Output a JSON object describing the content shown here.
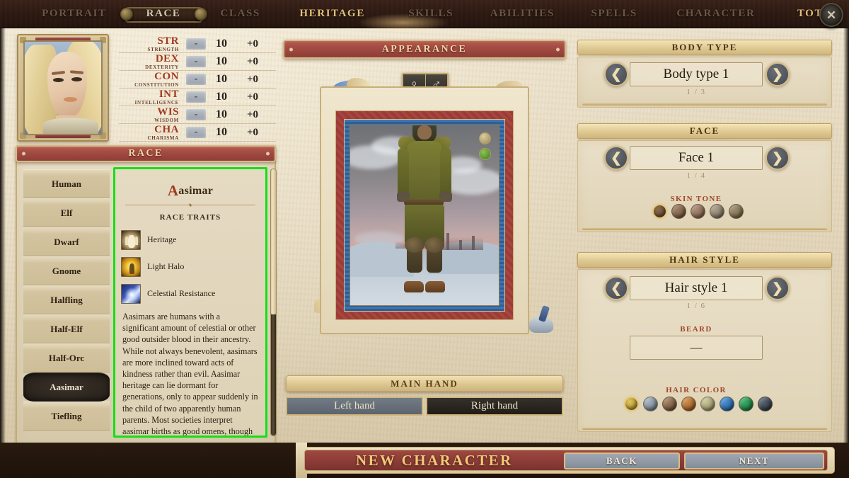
{
  "topbar": {
    "tabs": [
      {
        "label": "PORTRAIT",
        "state": "dim"
      },
      {
        "label": "RACE",
        "state": "active"
      },
      {
        "label": "CLASS",
        "state": "dim"
      },
      {
        "label": "HERITAGE",
        "state": "gold"
      },
      {
        "label": "SKILLS",
        "state": "dim"
      },
      {
        "label": "ABILITIES",
        "state": "dim"
      },
      {
        "label": "SPELLS",
        "state": "dim"
      },
      {
        "label": "CHARACTER",
        "state": "dim"
      },
      {
        "label": "TOTAL",
        "state": "gold"
      }
    ],
    "close_icon": "close-icon",
    "close_glyph": "✕"
  },
  "stats": {
    "rows": [
      {
        "abbr": "STR",
        "name": "STRENGTH",
        "minus": "-",
        "value": "10",
        "mod": "+0"
      },
      {
        "abbr": "DEX",
        "name": "DEXTERITY",
        "minus": "-",
        "value": "10",
        "mod": "+0"
      },
      {
        "abbr": "CON",
        "name": "CONSTITUTION",
        "minus": "-",
        "value": "10",
        "mod": "+0"
      },
      {
        "abbr": "INT",
        "name": "INTELLIGENCE",
        "minus": "-",
        "value": "10",
        "mod": "+0"
      },
      {
        "abbr": "WIS",
        "name": "WISDOM",
        "minus": "-",
        "value": "10",
        "mod": "+0"
      },
      {
        "abbr": "CHA",
        "name": "CHARISMA",
        "minus": "-",
        "value": "10",
        "mod": "+0"
      }
    ]
  },
  "race_section": {
    "banner_label": "RACE",
    "list": [
      {
        "label": "Human",
        "selected": false
      },
      {
        "label": "Elf",
        "selected": false
      },
      {
        "label": "Dwarf",
        "selected": false
      },
      {
        "label": "Gnome",
        "selected": false
      },
      {
        "label": "Halfling",
        "selected": false
      },
      {
        "label": "Half-Elf",
        "selected": false
      },
      {
        "label": "Half-Orc",
        "selected": false
      },
      {
        "label": "Aasimar",
        "selected": true
      },
      {
        "label": "Tiefling",
        "selected": false
      }
    ],
    "detail": {
      "title_dropcap": "A",
      "title_rest": "asimar",
      "traits_heading": "RACE TRAITS",
      "traits": [
        {
          "label": "Heritage",
          "icon": "heritage-icon"
        },
        {
          "label": "Light Halo",
          "icon": "light-halo-icon"
        },
        {
          "label": "Celestial Resistance",
          "icon": "celestial-resistance-icon"
        }
      ],
      "description": "Aasimars are humans with a significant amount of celestial or other good outsider blood in their ancestry. While not always benevolent, aasimars are more inclined toward acts of kindness rather than evil. Aasimar heritage can lie dormant for generations, only to appear suddenly in the child of two apparently human parents. Most societies interpret aasimar births as good omens, though it must be acknowledged that some aasimars take advantage of the"
    }
  },
  "appearance": {
    "banner_label": "APPEARANCE",
    "gender": {
      "female_glyph": "♀",
      "male_glyph": "♂",
      "selected": "female"
    },
    "view_dots": [
      {
        "name": "tan-view-dot",
        "color": "#b8a86f"
      },
      {
        "name": "green-view-dot",
        "color": "#5ea22e"
      }
    ]
  },
  "main_hand": {
    "banner_label": "MAIN HAND",
    "options": [
      {
        "label": "Left hand",
        "selected": false
      },
      {
        "label": "Right hand",
        "selected": true
      }
    ]
  },
  "customization": {
    "body_type": {
      "banner_label": "BODY TYPE",
      "value": "Body type 1",
      "counter": "1 / 3",
      "prev_glyph": "❮",
      "next_glyph": "❯"
    },
    "face": {
      "banner_label": "FACE",
      "value": "Face 1",
      "counter": "1 / 4",
      "prev_glyph": "❮",
      "next_glyph": "❯",
      "skin_tone_label": "SKIN TONE",
      "skin_tones": [
        {
          "color": "#6f5338",
          "selected": true
        },
        {
          "color": "#7d6048",
          "selected": false
        },
        {
          "color": "#8d705c",
          "selected": false
        },
        {
          "color": "#8d8172",
          "selected": false
        },
        {
          "color": "#82725a",
          "selected": false
        }
      ]
    },
    "hair_style": {
      "banner_label": "HAIR STYLE",
      "value": "Hair style 1",
      "counter": "1 / 6",
      "prev_glyph": "❮",
      "next_glyph": "❯",
      "beard_label": "BEARD",
      "beard_value": "—",
      "hair_color_label": "HAIR COLOR",
      "hair_colors": [
        {
          "color": "#c8ab3a",
          "selected": true
        },
        {
          "color": "#8b99a6",
          "selected": false
        },
        {
          "color": "#8a6a52",
          "selected": false
        },
        {
          "color": "#b5723a",
          "selected": false
        },
        {
          "color": "#b7b084",
          "selected": false
        },
        {
          "color": "#2f74bc",
          "selected": false
        },
        {
          "color": "#249150",
          "selected": false
        },
        {
          "color": "#3f4a57",
          "selected": false
        }
      ]
    }
  },
  "bottombar": {
    "title": "NEW CHARACTER",
    "back_label": "BACK",
    "next_label": "NEXT"
  }
}
